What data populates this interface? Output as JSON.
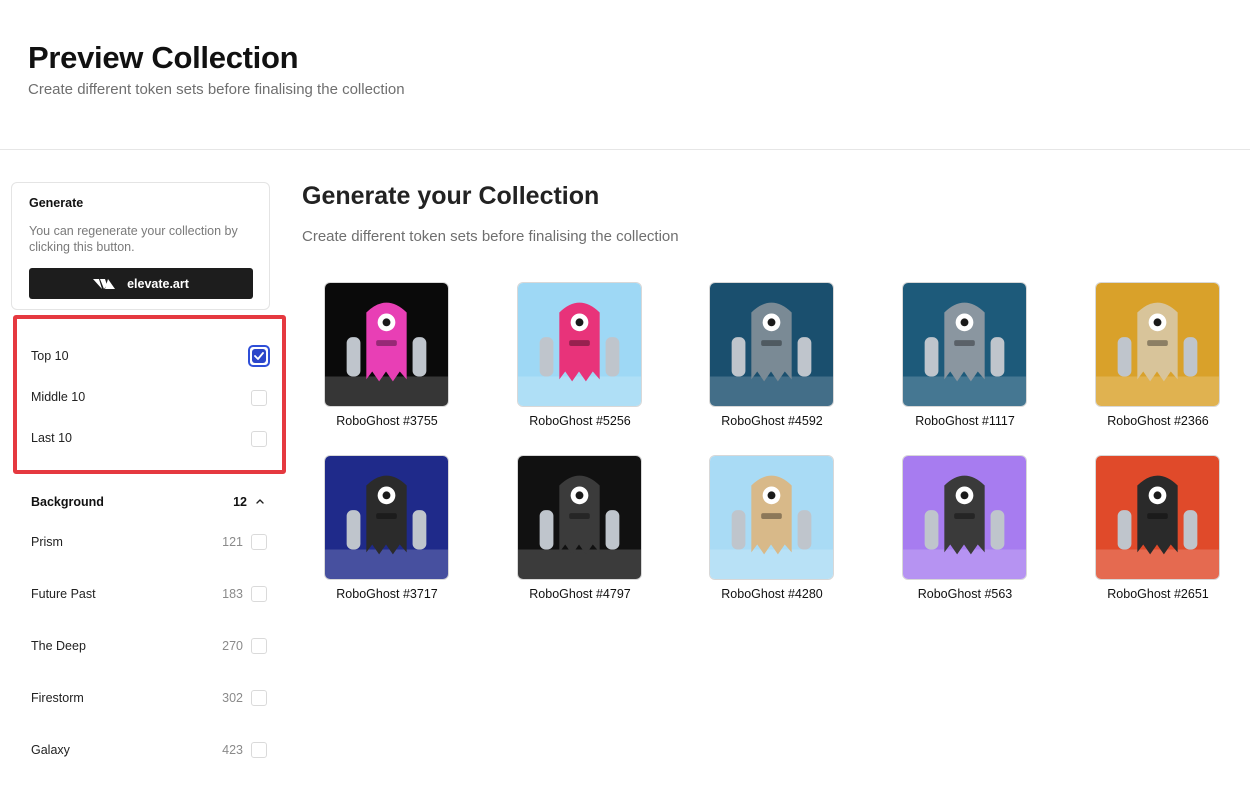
{
  "header": {
    "title": "Preview Collection",
    "subtitle": "Create different token sets before finalising the collection"
  },
  "generate_card": {
    "title": "Generate",
    "description": "You can regenerate your collection by clicking this button.",
    "button_label": "elevate.art",
    "button_icon": "elevate-logo-icon"
  },
  "quick_filters": [
    {
      "label": "Top 10",
      "checked": true
    },
    {
      "label": "Middle 10",
      "checked": false
    },
    {
      "label": "Last 10",
      "checked": false
    }
  ],
  "background_filter": {
    "label": "Background",
    "count": "12",
    "icon": "chevron-up-icon",
    "options": [
      {
        "label": "Prism",
        "count": "121"
      },
      {
        "label": "Future Past",
        "count": "183"
      },
      {
        "label": "The Deep",
        "count": "270"
      },
      {
        "label": "Firestorm",
        "count": "302"
      },
      {
        "label": "Galaxy",
        "count": "423"
      }
    ]
  },
  "main": {
    "title": "Generate your Collection",
    "subtitle": "Create different token sets before finalising the collection"
  },
  "tokens": [
    {
      "name": "RoboGhost #3755",
      "bg": "#0a0a0a",
      "body": "#e83fb5"
    },
    {
      "name": "RoboGhost #5256",
      "bg": "#9ed8f5",
      "body": "#e8337a"
    },
    {
      "name": "RoboGhost #4592",
      "bg": "#1a4f6e",
      "body": "#7a8a95"
    },
    {
      "name": "RoboGhost #1117",
      "bg": "#1d5a7a",
      "body": "#8a96a0"
    },
    {
      "name": "RoboGhost #2366",
      "bg": "#d9a12a",
      "body": "#d8c49a"
    },
    {
      "name": "RoboGhost #3717",
      "bg": "#1f2a8a",
      "body": "#2b2b2b"
    },
    {
      "name": "RoboGhost #4797",
      "bg": "#111111",
      "body": "#3b3b3b"
    },
    {
      "name": "RoboGhost #4280",
      "bg": "#a9dbf5",
      "body": "#d8b989"
    },
    {
      "name": "RoboGhost #563",
      "bg": "#a77cf0",
      "body": "#3a3a3a"
    },
    {
      "name": "RoboGhost #2651",
      "bg": "#e04a2a",
      "body": "#2a2a2a"
    }
  ],
  "colors": {
    "highlight": "#e53940",
    "checkbox_accent": "#2c46c9",
    "button_bg": "#1d1d1d"
  }
}
